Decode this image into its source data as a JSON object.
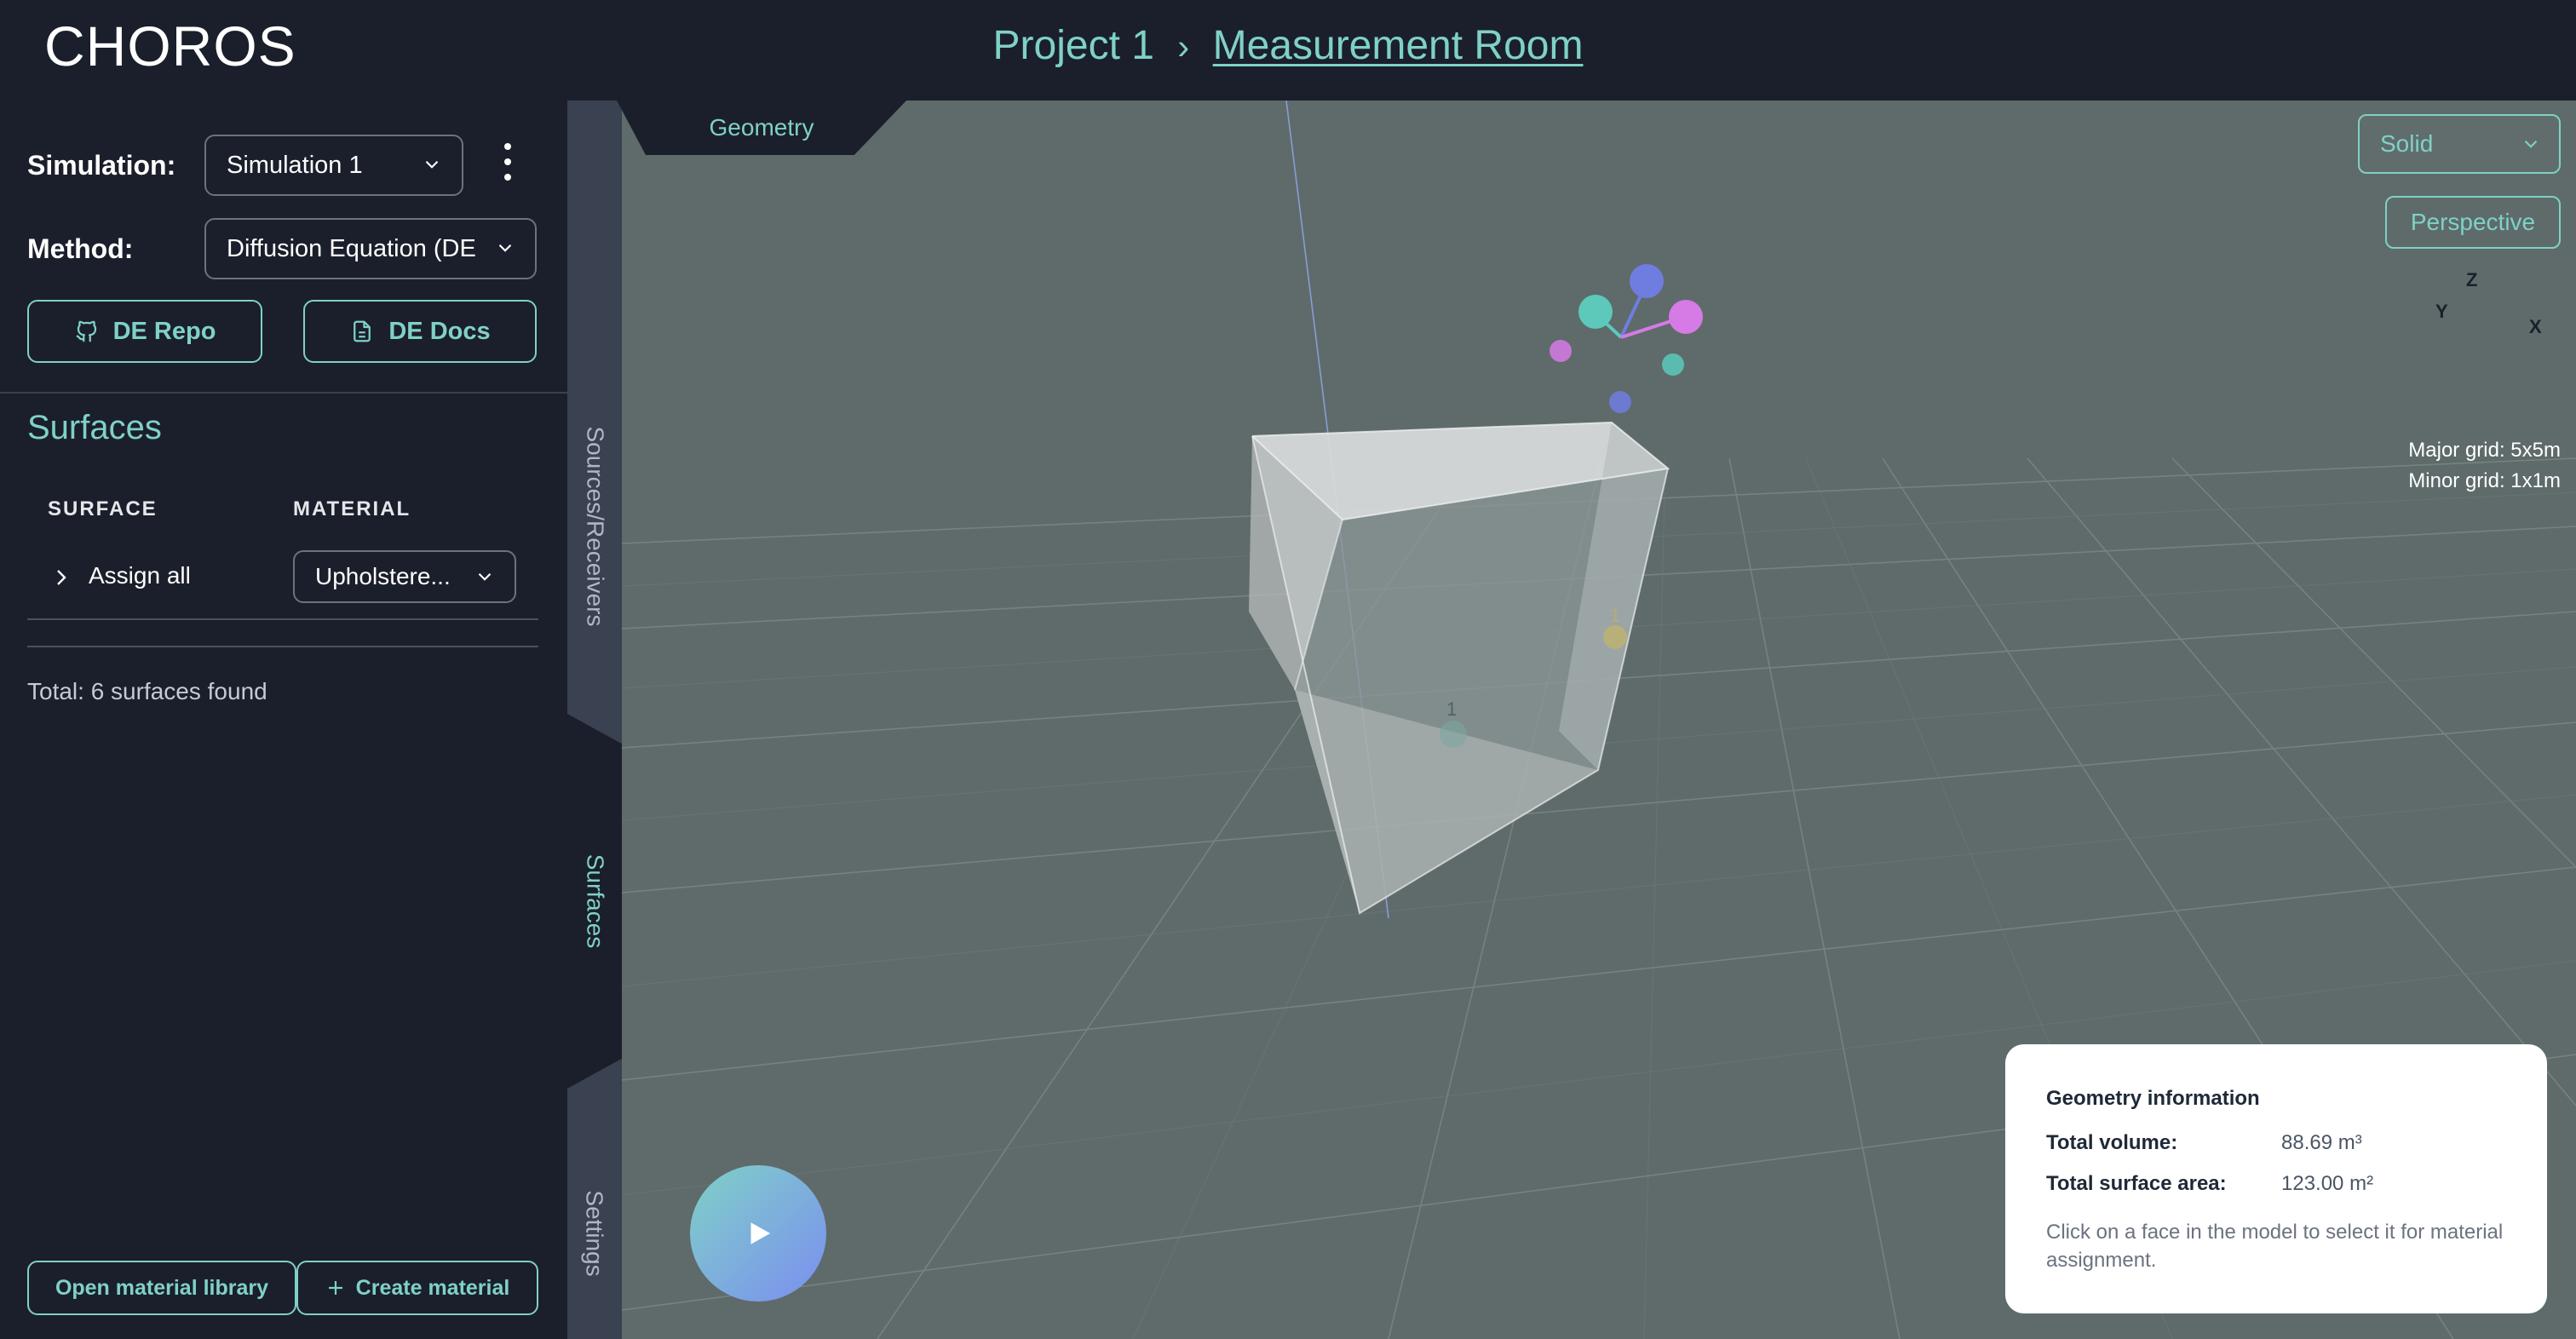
{
  "app": {
    "logo": "CHOROS"
  },
  "breadcrumb": {
    "project": "Project 1",
    "separator": "›",
    "room": "Measurement Room"
  },
  "simulation": {
    "label": "Simulation:",
    "selected": "Simulation 1",
    "method_label": "Method:",
    "method_selected": "Diffusion Equation (DE"
  },
  "buttons": {
    "repo": "DE Repo",
    "docs": "DE Docs"
  },
  "surfaces": {
    "title": "Surfaces",
    "col_surface": "SURFACE",
    "col_material": "MATERIAL",
    "assign_all": "Assign all",
    "material_selected": "Upholstere...",
    "total": "Total: 6 surfaces found"
  },
  "footer_buttons": {
    "library": "Open material library",
    "create": "Create material"
  },
  "rail_tabs": {
    "sources": "Sources/Receivers",
    "surfaces": "Surfaces",
    "settings": "Settings"
  },
  "viewport": {
    "tab": "Geometry",
    "render_mode": "Solid",
    "camera": "Perspective",
    "major_grid": "Major grid: 5x5m",
    "minor_grid": "Minor grid: 1x1m",
    "axes": {
      "z": "Z",
      "y": "Y",
      "x": "X"
    },
    "markers": {
      "source": "1",
      "receiver": "1"
    }
  },
  "geometry_info": {
    "title": "Geometry information",
    "volume_label": "Total volume:",
    "volume_value": "88.69 m³",
    "area_label": "Total surface area:",
    "area_value": "123.00 m²",
    "hint": "Click on a face in the model to select it for material assignment."
  },
  "colors": {
    "accent": "#7fd1c7",
    "panel": "#1b1f2b",
    "viewport": "#5e6b6a",
    "axis_x": "#d67ae6",
    "axis_y": "#5cc9bb",
    "axis_z": "#6f7de0"
  }
}
